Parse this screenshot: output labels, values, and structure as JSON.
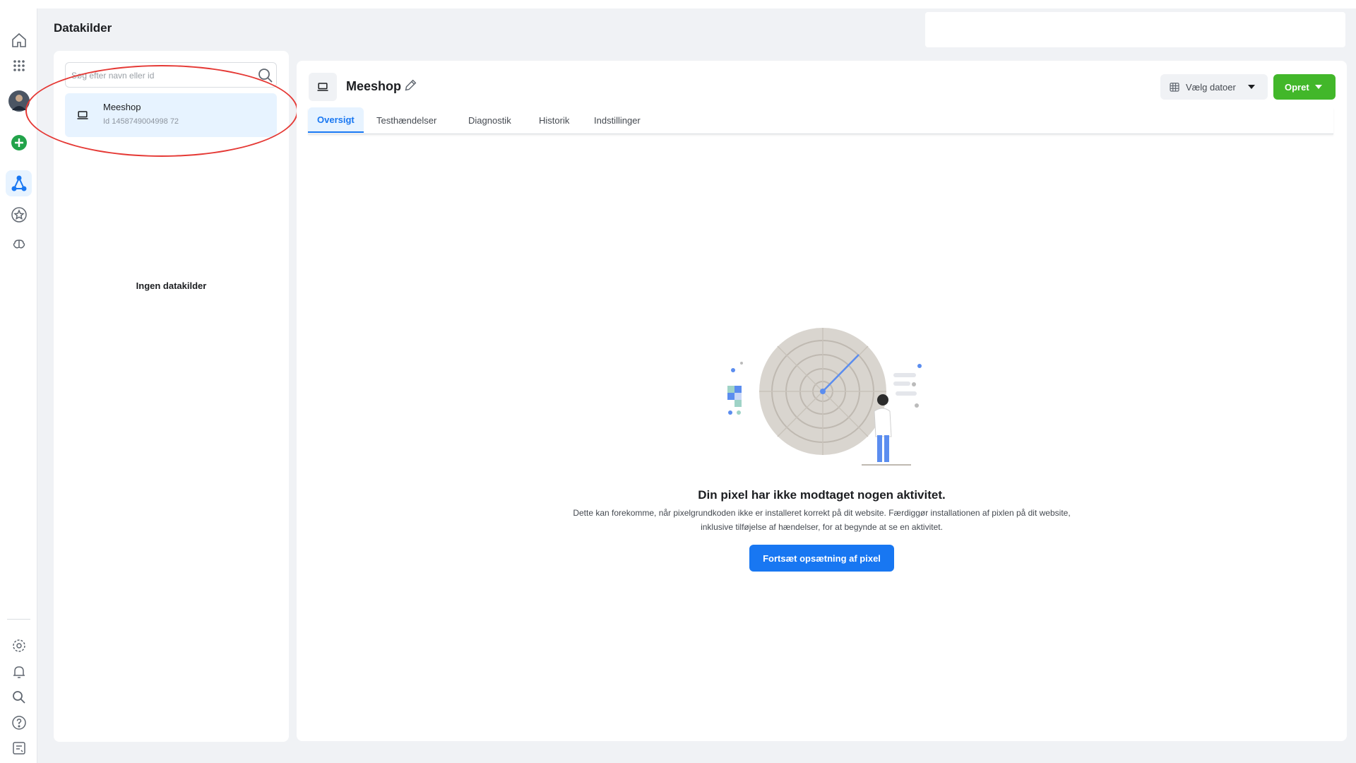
{
  "header": {
    "title": "Datakilder"
  },
  "sidebar": {
    "items": [
      {
        "icon": "home-icon"
      },
      {
        "icon": "apps-grid-icon"
      },
      {
        "icon": "avatar"
      },
      {
        "icon": "add-circle-icon"
      },
      {
        "icon": "data-sources-icon",
        "active": true
      },
      {
        "icon": "star-badge-icon"
      },
      {
        "icon": "brain-icon"
      }
    ],
    "bottom_items": [
      {
        "icon": "gear-icon"
      },
      {
        "icon": "bell-icon"
      },
      {
        "icon": "search-icon"
      },
      {
        "icon": "help-icon"
      },
      {
        "icon": "report-icon"
      }
    ]
  },
  "list_panel": {
    "search_placeholder": "Søg efter navn eller id",
    "items": [
      {
        "name": "Meeshop",
        "id_text": "Id 1458749004998 72"
      }
    ],
    "empty_text": "Ingen datakilder"
  },
  "main": {
    "title": "Meeshop",
    "date_button": "Vælg datoer",
    "create_button": "Opret",
    "tabs": [
      {
        "label": "Oversigt",
        "active": true
      },
      {
        "label": "Testhændelser"
      },
      {
        "label": "Diagnostik"
      },
      {
        "label": "Historik"
      },
      {
        "label": "Indstillinger"
      }
    ],
    "empty_state": {
      "title": "Din pixel har ikke modtaget nogen aktivitet.",
      "description": "Dette kan forekomme, når pixelgrundkoden ikke er installeret korrekt på dit website. Færdiggør installationen af pixlen på dit website, inklusive tilføjelse af hændelser, for at begynde at se en aktivitet.",
      "button": "Fortsæt opsætning af pixel"
    }
  },
  "colors": {
    "accent": "#1877f2",
    "create": "#42b72a",
    "highlight": "#e53935",
    "selected_bg": "#e7f3ff"
  }
}
